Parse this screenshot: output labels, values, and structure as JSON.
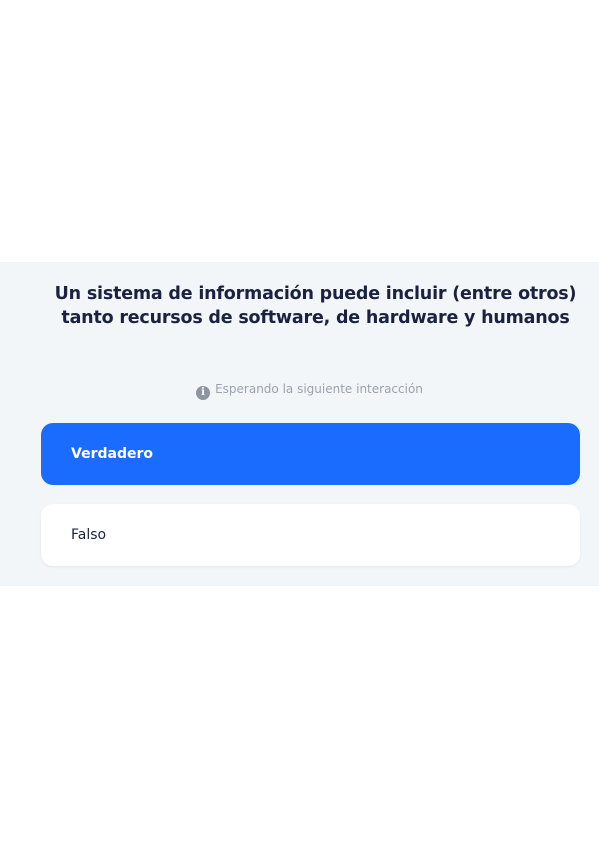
{
  "question": {
    "text": "Un sistema de información puede incluir (entre otros) tanto recursos de software, de hardware y humanos"
  },
  "status": {
    "icon": "info-icon",
    "text": "Esperando la siguiente interacción"
  },
  "options": [
    {
      "label": "Verdadero",
      "selected": true
    },
    {
      "label": "Falso",
      "selected": false
    }
  ],
  "colors": {
    "accent": "#1a6cff",
    "panel_background": "#f3f6f9",
    "marker": "#e01a1a"
  }
}
